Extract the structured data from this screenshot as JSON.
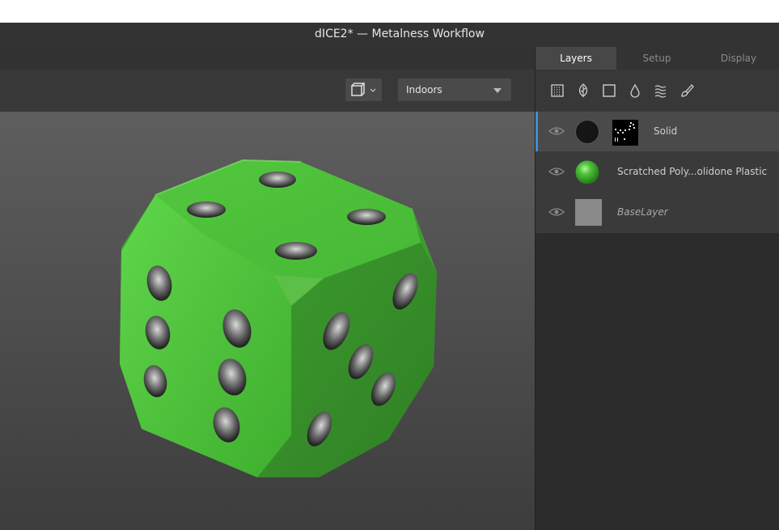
{
  "window": {
    "title": "dICE2* — Metalness Workflow"
  },
  "viewport": {
    "environment_select": {
      "value": "Indoors"
    },
    "view_toggle_icon": "cube-view-icon"
  },
  "panel": {
    "tabs": [
      {
        "label": "Layers",
        "active": true
      },
      {
        "label": "Setup",
        "active": false
      },
      {
        "label": "Display",
        "active": false
      }
    ],
    "tool_icons": [
      "pattern-grid-icon",
      "leaf-icon",
      "square-icon",
      "drop-icon",
      "waves-icon",
      "brush-icon"
    ],
    "layers": [
      {
        "name": "Solid",
        "selected": true
      },
      {
        "name": "Scratched Poly...olidone Plastic",
        "selected": false
      },
      {
        "name": "BaseLayer",
        "selected": false,
        "italic": true
      }
    ]
  },
  "colors": {
    "accent": "#3b8fd8",
    "dice_green": "#4fc33c"
  }
}
